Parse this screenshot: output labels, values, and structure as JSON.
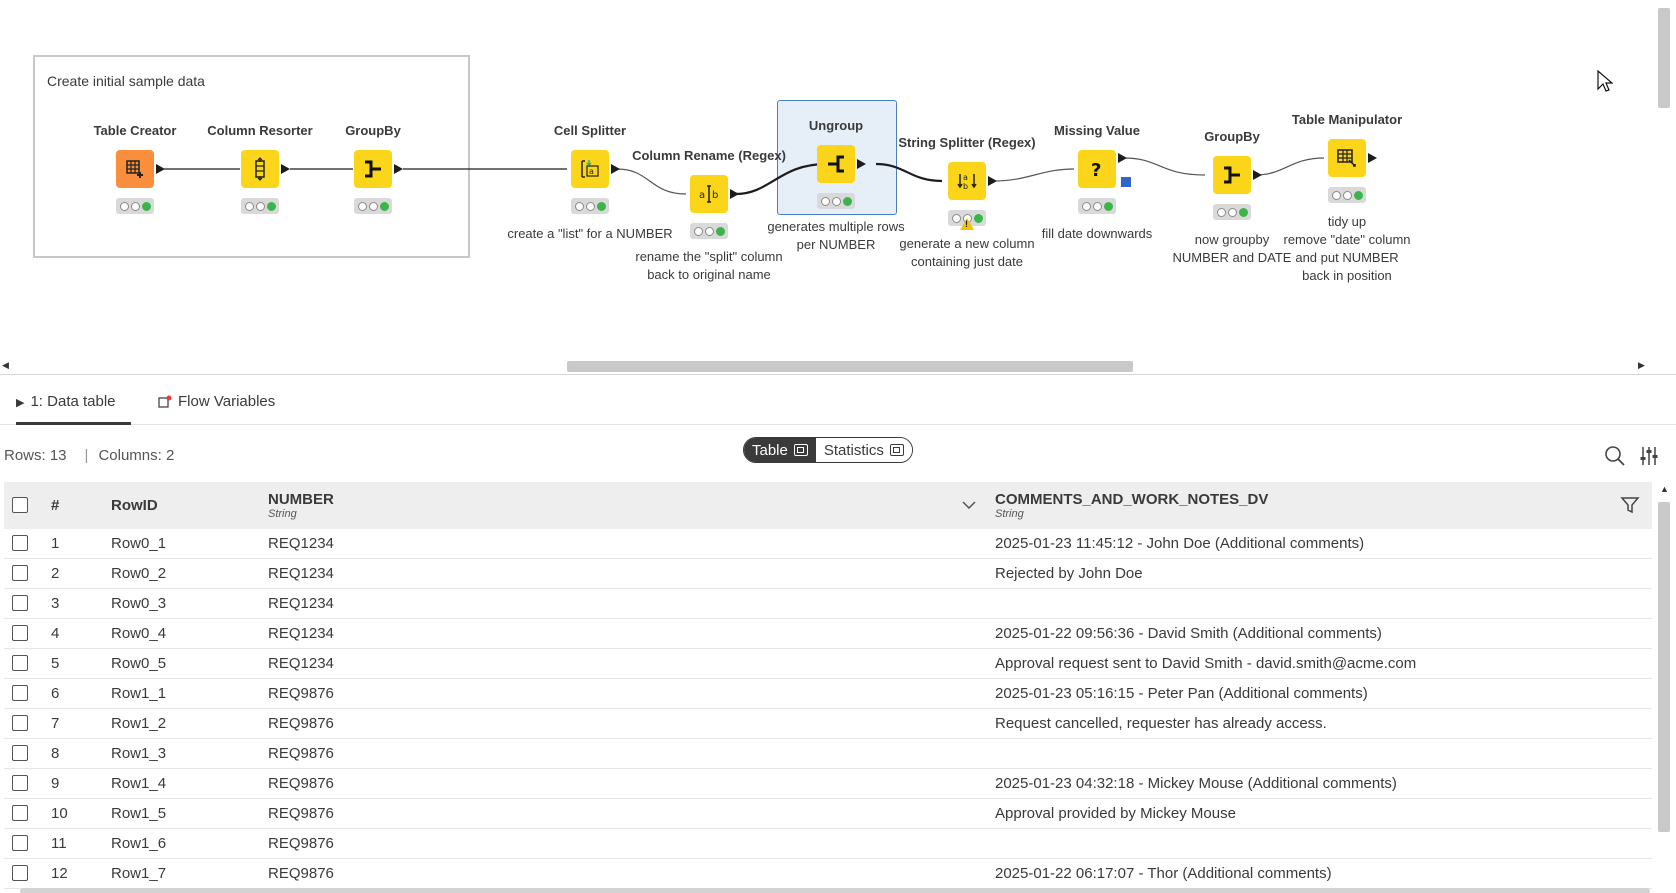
{
  "canvas": {
    "annotation": "Create initial sample data",
    "nodes": [
      {
        "title": "Table Creator",
        "desc": ""
      },
      {
        "title": "Column Resorter",
        "desc": ""
      },
      {
        "title": "GroupBy",
        "desc": ""
      },
      {
        "title": "Cell Splitter",
        "desc": "create a \"list\" for a NUMBER"
      },
      {
        "title": "Column Rename (Regex)",
        "desc": "rename the \"split\" column\nback to original name"
      },
      {
        "title": "Ungroup",
        "desc": "generates multiple rows\nper NUMBER"
      },
      {
        "title": "String Splitter (Regex)",
        "desc": "generate a new column\ncontaining just date"
      },
      {
        "title": "Missing Value",
        "desc": "fill date downwards"
      },
      {
        "title": "GroupBy",
        "desc": "now groupby\nNUMBER and DATE"
      },
      {
        "title": "Table Manipulator",
        "desc": "tidy up\nremove \"date\" column\nand put NUMBER\nback in position"
      }
    ]
  },
  "panel": {
    "tabs": [
      {
        "label": "1: Data table",
        "icon": "play-triangle-icon"
      },
      {
        "label": "Flow Variables",
        "icon": "flow-variable-icon"
      }
    ],
    "rows_label": "Rows: 13",
    "cols_label": "Columns: 2",
    "separator": "|",
    "toggle": {
      "table": "Table",
      "statistics": "Statistics"
    },
    "columns": [
      {
        "name": "#",
        "type": ""
      },
      {
        "name": "RowID",
        "type": ""
      },
      {
        "name": "NUMBER",
        "type": "String"
      },
      {
        "name": "COMMENTS_AND_WORK_NOTES_DV",
        "type": "String"
      }
    ],
    "rows": [
      [
        "1",
        "Row0_1",
        "REQ1234",
        "2025-01-23 11:45:12 - John Doe (Additional comments)"
      ],
      [
        "2",
        "Row0_2",
        "REQ1234",
        "Rejected by John Doe"
      ],
      [
        "3",
        "Row0_3",
        "REQ1234",
        ""
      ],
      [
        "4",
        "Row0_4",
        "REQ1234",
        "2025-01-22 09:56:36 - David Smith (Additional comments)"
      ],
      [
        "5",
        "Row0_5",
        "REQ1234",
        "Approval request sent to David Smith - david.smith@acme.com"
      ],
      [
        "6",
        "Row1_1",
        "REQ9876",
        "2025-01-23 05:16:15 - Peter Pan (Additional comments)"
      ],
      [
        "7",
        "Row1_2",
        "REQ9876",
        "Request cancelled, requester has already access."
      ],
      [
        "8",
        "Row1_3",
        "REQ9876",
        ""
      ],
      [
        "9",
        "Row1_4",
        "REQ9876",
        "2025-01-23 04:32:18 - Mickey Mouse (Additional comments)"
      ],
      [
        "10",
        "Row1_5",
        "REQ9876",
        "Approval provided by Mickey Mouse"
      ],
      [
        "11",
        "Row1_6",
        "REQ9876",
        ""
      ],
      [
        "12",
        "Row1_7",
        "REQ9876",
        "2025-01-22 06:17:07 - Thor (Additional comments)"
      ]
    ]
  },
  "colors": {
    "node_yellow": "#fbd51a",
    "node_orange": "#f98e3c",
    "status_green": "#3bb54a",
    "selection_blue": "#e6eef8"
  }
}
